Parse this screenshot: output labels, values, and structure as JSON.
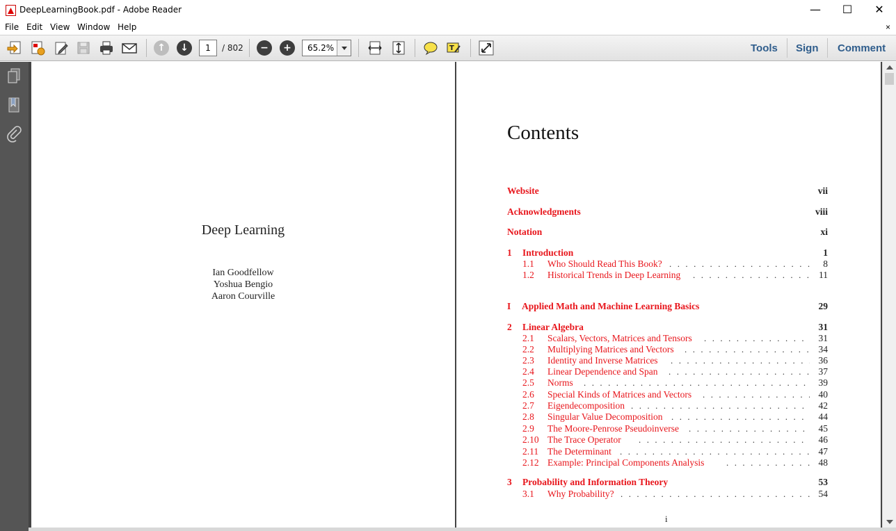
{
  "window": {
    "title": "DeepLearningBook.pdf - Adobe Reader",
    "minimize": "—",
    "maximize": "☐",
    "close": "✕"
  },
  "menu": {
    "items": [
      "File",
      "Edit",
      "View",
      "Window",
      "Help"
    ],
    "close": "×"
  },
  "toolbar": {
    "page_current": "1",
    "page_total": "/ 802",
    "zoom": "65.2%",
    "tools": "Tools",
    "sign": "Sign",
    "comment": "Comment"
  },
  "left_page": {
    "title": "Deep Learning",
    "authors": [
      "Ian Goodfellow",
      "Yoshua Bengio",
      "Aaron Courville"
    ]
  },
  "right_page": {
    "heading": "Contents",
    "footer": "i",
    "front_matter": [
      {
        "title": "Website",
        "page": "vii"
      },
      {
        "title": "Acknowledgments",
        "page": "viii"
      },
      {
        "title": "Notation",
        "page": "xi"
      }
    ],
    "chapter1": {
      "num": "1",
      "title": "Introduction",
      "page": "1",
      "sections": [
        {
          "num": "1.1",
          "title": "Who Should Read This Book?",
          "page": "8"
        },
        {
          "num": "1.2",
          "title": "Historical Trends in Deep Learning",
          "page": "11"
        }
      ]
    },
    "part1": {
      "num": "I",
      "title": "Applied Math and Machine Learning Basics",
      "page": "29"
    },
    "chapter2": {
      "num": "2",
      "title": "Linear Algebra",
      "page": "31",
      "sections": [
        {
          "num": "2.1",
          "title": "Scalars, Vectors, Matrices and Tensors",
          "page": "31"
        },
        {
          "num": "2.2",
          "title": "Multiplying Matrices and Vectors",
          "page": "34"
        },
        {
          "num": "2.3",
          "title": "Identity and Inverse Matrices",
          "page": "36"
        },
        {
          "num": "2.4",
          "title": "Linear Dependence and Span",
          "page": "37"
        },
        {
          "num": "2.5",
          "title": "Norms",
          "page": "39"
        },
        {
          "num": "2.6",
          "title": "Special Kinds of Matrices and Vectors",
          "page": "40"
        },
        {
          "num": "2.7",
          "title": "Eigendecomposition",
          "page": "42"
        },
        {
          "num": "2.8",
          "title": "Singular Value Decomposition",
          "page": "44"
        },
        {
          "num": "2.9",
          "title": "The Moore-Penrose Pseudoinverse",
          "page": "45"
        },
        {
          "num": "2.10",
          "title": "The Trace Operator",
          "page": "46"
        },
        {
          "num": "2.11",
          "title": "The Determinant",
          "page": "47"
        },
        {
          "num": "2.12",
          "title": "Example: Principal Components Analysis",
          "page": "48"
        }
      ]
    },
    "chapter3": {
      "num": "3",
      "title": "Probability and Information Theory",
      "page": "53",
      "sections": [
        {
          "num": "3.1",
          "title": "Why Probability?",
          "page": "54"
        }
      ]
    }
  },
  "colors": {
    "link_red": "#e8161c",
    "toolbar_link": "#2f5d8c",
    "side_panel": "#555555",
    "document_bg": "#444444"
  },
  "icons": [
    "create-pdf-icon",
    "open-icon",
    "edit-icon",
    "save-icon",
    "print-icon",
    "email-icon",
    "previous-page-icon",
    "next-page-icon",
    "zoom-out-icon",
    "zoom-in-icon",
    "fit-width-icon",
    "fit-page-icon",
    "sticky-note-icon",
    "highlight-icon",
    "full-screen-icon",
    "pages-panel-icon",
    "bookmarks-icon",
    "attachments-icon"
  ]
}
